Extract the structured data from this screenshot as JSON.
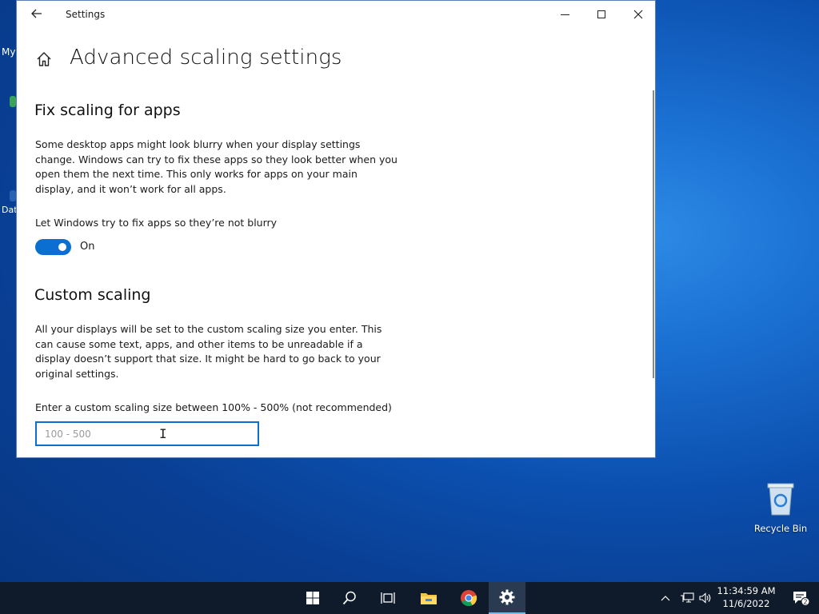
{
  "window": {
    "title": "Settings",
    "back_icon": "arrow-left-icon",
    "controls": [
      "minimize-icon",
      "maximize-icon",
      "close-icon"
    ]
  },
  "page": {
    "home_icon": "home-icon",
    "title": "Advanced scaling settings"
  },
  "fix_scaling": {
    "heading": "Fix scaling for apps",
    "description": "Some desktop apps might look blurry when your display settings change. Windows can try to fix these apps so they look better when you open them the next time. This only works for apps on your main display, and it won’t work for all apps.",
    "toggle_label": "Let Windows try to fix apps so they’re not blurry",
    "toggle_state": "On"
  },
  "custom_scaling": {
    "heading": "Custom scaling",
    "description": "All your displays will be set to the custom scaling size you enter. This can cause some text, apps, and other items to be unreadable if a display doesn’t support that size. It might be hard to go back to your original settings.",
    "input_label": "Enter a custom scaling size between 100% - 500% (not recommended)",
    "input_placeholder": "100 - 500",
    "input_value": ""
  },
  "desktop": {
    "recycle_bin_label": "Recycle Bin",
    "edge_label_top": "My",
    "edge_label_bottom": "Dat"
  },
  "taskbar": {
    "items": [
      "start-icon",
      "search-icon",
      "task-view-icon",
      "file-explorer-icon",
      "chrome-icon",
      "settings-icon"
    ],
    "active_item": "settings-icon",
    "tray_icons": [
      "chevron-up-icon",
      "network-icon",
      "volume-icon"
    ],
    "time": "11:34:59 AM",
    "date": "11/6/2022",
    "notification_count": "2"
  },
  "colors": {
    "accent": "#0b6fd1",
    "taskbar": "#0f1b2b",
    "desktop": "#0b4fae"
  }
}
